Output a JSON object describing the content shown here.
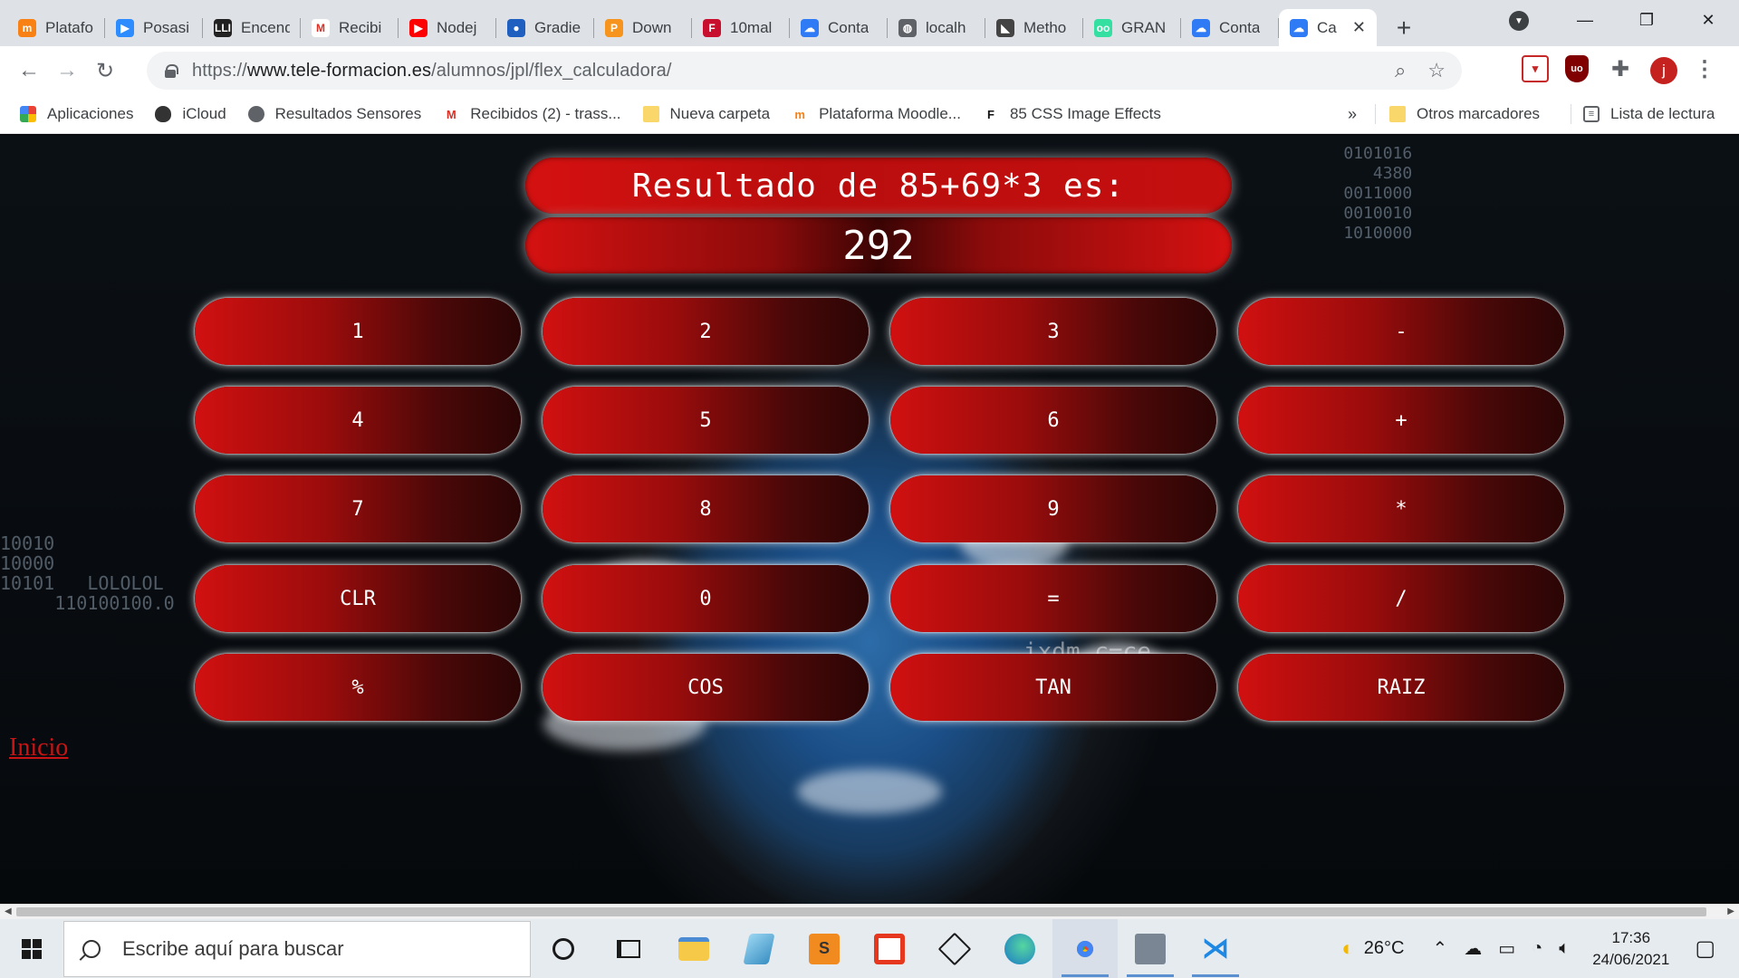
{
  "browser": {
    "tabs": [
      {
        "label": "Platafo",
        "icon": "moodle-icon",
        "color": "#f98012",
        "glyph": "m"
      },
      {
        "label": "Posasi",
        "icon": "zoom-icon",
        "color": "#2d8cff",
        "glyph": "▶"
      },
      {
        "label": "Encend",
        "icon": "lli-icon",
        "color": "#222222",
        "glyph": "LLI"
      },
      {
        "label": "Recibi",
        "icon": "gmail-icon",
        "color": "#ffffff",
        "glyph": "M"
      },
      {
        "label": "Nodej",
        "icon": "youtube-icon",
        "color": "#ff0000",
        "glyph": "▶"
      },
      {
        "label": "Gradie",
        "icon": "gradient-icon",
        "color": "#1f5fbf",
        "glyph": "●"
      },
      {
        "label": "Down",
        "icon": "download-icon",
        "color": "#f7941d",
        "glyph": "P"
      },
      {
        "label": "10mal",
        "icon": "tenmal-icon",
        "color": "#c8102e",
        "glyph": "F"
      },
      {
        "label": "Conta",
        "icon": "cloud-icon",
        "color": "#2f7bf5",
        "glyph": "☁"
      },
      {
        "label": "localh",
        "icon": "globe-icon",
        "color": "#5f6368",
        "glyph": "◍"
      },
      {
        "label": "Metho",
        "icon": "method-icon",
        "color": "#444444",
        "glyph": "◣"
      },
      {
        "label": "GRAN",
        "icon": "tripadvisor-icon",
        "color": "#34e0a1",
        "glyph": "oo"
      },
      {
        "label": "Conta",
        "icon": "cloud-icon",
        "color": "#2f7bf5",
        "glyph": "☁"
      },
      {
        "label": "Ca",
        "icon": "cloud-icon",
        "color": "#2f7bf5",
        "glyph": "☁",
        "active": true
      }
    ],
    "url_scheme": "https://",
    "url_host": "www.tele-formacion.es",
    "url_path": "/alumnos/jpl/flex_calculadora/",
    "avatar_letter": "j",
    "bookmarks": [
      {
        "label": "Aplicaciones",
        "icon": "apps-grid-icon"
      },
      {
        "label": "iCloud",
        "icon": "apple-icon"
      },
      {
        "label": "Resultados Sensores",
        "icon": "globe-icon"
      },
      {
        "label": "Recibidos (2) - trass...",
        "icon": "gmail-icon"
      },
      {
        "label": "Nueva carpeta",
        "icon": "folder-icon"
      },
      {
        "label": "Plataforma Moodle...",
        "icon": "moodle-icon"
      },
      {
        "label": "85 CSS Image Effects",
        "icon": "f-logo-icon"
      }
    ],
    "bookmarks_overflow": "»",
    "other_bookmarks": "Otros marcadores",
    "reading_list": "Lista de lectura"
  },
  "calculator": {
    "title": "Resultado de 85+69*3 es:",
    "result": "292",
    "buttons": [
      [
        "1",
        "2",
        "3",
        "-"
      ],
      [
        "4",
        "5",
        "6",
        "+"
      ],
      [
        "7",
        "8",
        "9",
        "*"
      ],
      [
        "CLR",
        "0",
        "=",
        "/"
      ],
      [
        "%",
        "COS",
        "TAN",
        "RAIZ"
      ]
    ],
    "link": "Inicio"
  },
  "taskbar": {
    "search_placeholder": "Escribe aquí para buscar",
    "weather": "26°C",
    "time": "17:36",
    "date": "24/06/2021"
  },
  "colors": {
    "button_red": "#d11010",
    "link_red": "#c81414",
    "chrome_bg": "#dee1e6"
  }
}
